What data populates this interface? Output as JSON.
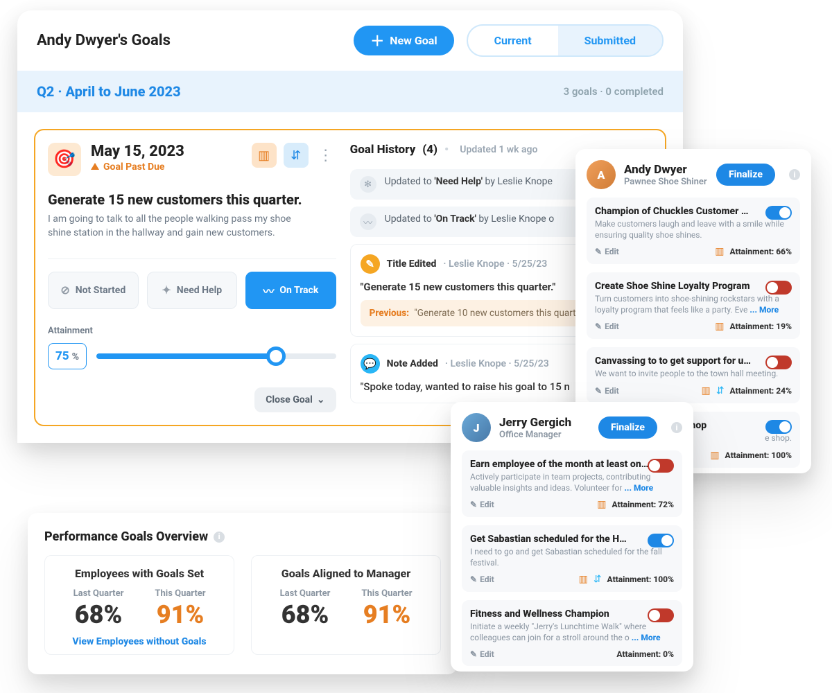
{
  "header": {
    "title": "Andy Dwyer's Goals",
    "newGoal": "New Goal",
    "tabs": {
      "current": "Current",
      "submitted": "Submitted"
    }
  },
  "period": {
    "label": "Q2 · April to June 2023",
    "stats": "3 goals · 0 completed"
  },
  "goal": {
    "date": "May 15, 2023",
    "pastDue": "Goal Past Due",
    "title": "Generate 15 new customers this quarter.",
    "desc": "I am going to talk to all the people walking pass my shoe shine station in the hallway and gain new customers.",
    "statuses": {
      "notStarted": "Not Started",
      "needHelp": "Need Help",
      "onTrack": "On Track"
    },
    "attainLabel": "Attainment",
    "attainValue": "75",
    "attainPct": "%",
    "closeGoal": "Close Goal"
  },
  "history": {
    "title": "Goal History",
    "count": "(4)",
    "updated": "Updated 1 wk ago",
    "u1_pre": "Updated to ",
    "u1_state": "'Need Help'",
    "u1_by": " by Leslie Knope",
    "u2_pre": "Updated to ",
    "u2_state": "'On Track'",
    "u2_by": " by Leslie Knope o",
    "edit_head": "Title Edited",
    "edit_meta": "· Leslie Knope · 5/25/23",
    "edit_body": "\"Generate 15 new customers this quarter.\"",
    "prev_tag": "Previous:",
    "prev_text": "\"Generate 10 new customers this quarte",
    "note_head": "Note Added",
    "note_meta": "· Leslie Knope · 5/25/23",
    "note_body": "\"Spoke today, wanted to raise his goal to 15 n"
  },
  "overview": {
    "title": "Performance Goals Overview",
    "cell1": {
      "title": "Employees with Goals Set",
      "last": "Last Quarter",
      "lastV": "68%",
      "this": "This Quarter",
      "thisV": "91%",
      "link": "View Employees without Goals"
    },
    "cell2": {
      "title": "Goals Aligned to Manager",
      "last": "Last Quarter",
      "lastV": "68%",
      "this": "This Quarter",
      "thisV": "91%"
    }
  },
  "andy": {
    "name": "Andy Dwyer",
    "role": "Pawnee Shoe Shiner",
    "finalize": "Finalize",
    "g1": {
      "title": "Champion of Chuckles Customer Satisfa…",
      "desc": "Make customers laugh and leave with a smile while ensuring quality shoe shines.",
      "att": "Attainment: 66%"
    },
    "g2": {
      "title": "Create Shoe Shine Loyalty Program",
      "desc": "Turn customers into shoe-shining rockstars with a loyalty program that feels like a party. Eve ",
      "more": "... More",
      "att": "Attainment: 19%"
    },
    "g3": {
      "title": "Canvassing to to get support for upcomi…",
      "desc": "We want to invite people to the town hall meeting.",
      "att": "Attainment: 24%"
    },
    "g4": {
      "title": "Start the shoe shine shop",
      "desc": "e shop.",
      "att": "Attainment: 100%"
    },
    "edit": "Edit"
  },
  "jerry": {
    "name": "Jerry Gergich",
    "role": "Office Manager",
    "finalize": "Finalize",
    "g1": {
      "title": "Earn employee of the month at least once.",
      "desc": "Actively participate in team projects, contributing valuable insights and ideas. Volunteer for  ",
      "more": "... More",
      "att": "Attainment: 72%"
    },
    "g2": {
      "title": "Get Sabastian scheduled for the Harves…",
      "desc": "I need to go and get Sabastian scheduled for the fall festival.",
      "att": "Attainment: 100%"
    },
    "g3": {
      "title": "Fitness and Wellness Champion",
      "desc": "Initiate a weekly \"Jerry's Lunchtime Walk\" where colleagues can join for a stroll around the o ",
      "more": "... More",
      "att": "Attainment: 0%"
    },
    "edit": "Edit"
  }
}
